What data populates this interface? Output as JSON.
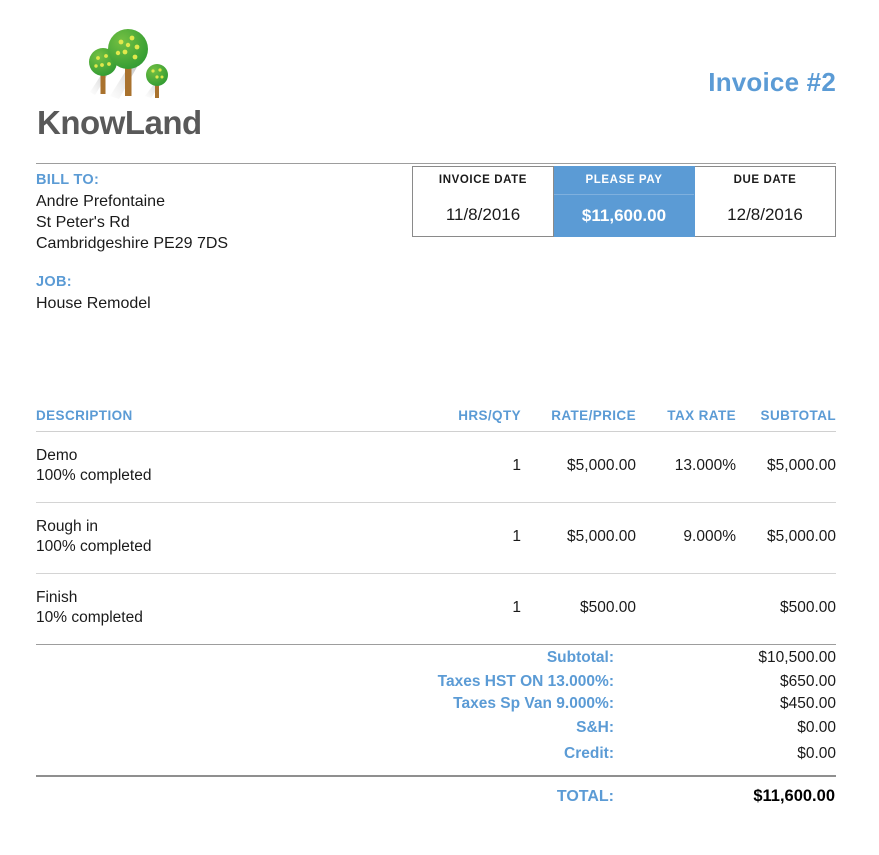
{
  "brand": {
    "name": "KnowLand",
    "logo_icon": "three-trees-icon",
    "wordmark_color": "#595959",
    "accent_color": "#5b9bd5",
    "tree_canopy_color": "#3faa35",
    "tree_dot_color": "#d9e24a",
    "tree_trunk_color": "#a9722e"
  },
  "header": {
    "invoice_title": "Invoice #2"
  },
  "bill_to": {
    "label": "BILL TO:",
    "name": "Andre Prefontaine",
    "street": "St Peter's Rd",
    "city_postcode": "Cambridgeshire  PE29 7DS"
  },
  "job": {
    "label": "JOB:",
    "value": "House Remodel"
  },
  "payment_summary": {
    "invoice_date": {
      "label": "INVOICE DATE",
      "value": "11/8/2016"
    },
    "please_pay": {
      "label": "PLEASE PAY",
      "value": "$11,600.00"
    },
    "due_date": {
      "label": "DUE DATE",
      "value": "12/8/2016"
    }
  },
  "items_table": {
    "columns": [
      "DESCRIPTION",
      "HRS/QTY",
      "RATE/PRICE",
      "TAX RATE",
      "SUBTOTAL"
    ],
    "rows": [
      {
        "description": "Demo",
        "description_note": "100% completed",
        "hrs_qty": "1",
        "rate_price": "$5,000.00",
        "tax_rate": "13.000%",
        "subtotal": "$5,000.00"
      },
      {
        "description": "Rough in",
        "description_note": "100% completed",
        "hrs_qty": "1",
        "rate_price": "$5,000.00",
        "tax_rate": "9.000%",
        "subtotal": "$5,000.00"
      },
      {
        "description": "Finish",
        "description_note": "10% completed",
        "hrs_qty": "1",
        "rate_price": "$500.00",
        "tax_rate": "",
        "subtotal": "$500.00"
      }
    ]
  },
  "totals": {
    "subtotal": {
      "label": "Subtotal:",
      "value": "$10,500.00"
    },
    "tax_hst": {
      "label": "Taxes HST ON 13.000%:",
      "value": "$650.00"
    },
    "tax_sp_van": {
      "label": "Taxes Sp Van 9.000%:",
      "value": "$450.00"
    },
    "shipping": {
      "label": "S&H:",
      "value": "$0.00"
    },
    "credit": {
      "label": "Credit:",
      "value": "$0.00"
    },
    "total": {
      "label": "TOTAL:",
      "value": "$11,600.00"
    }
  }
}
